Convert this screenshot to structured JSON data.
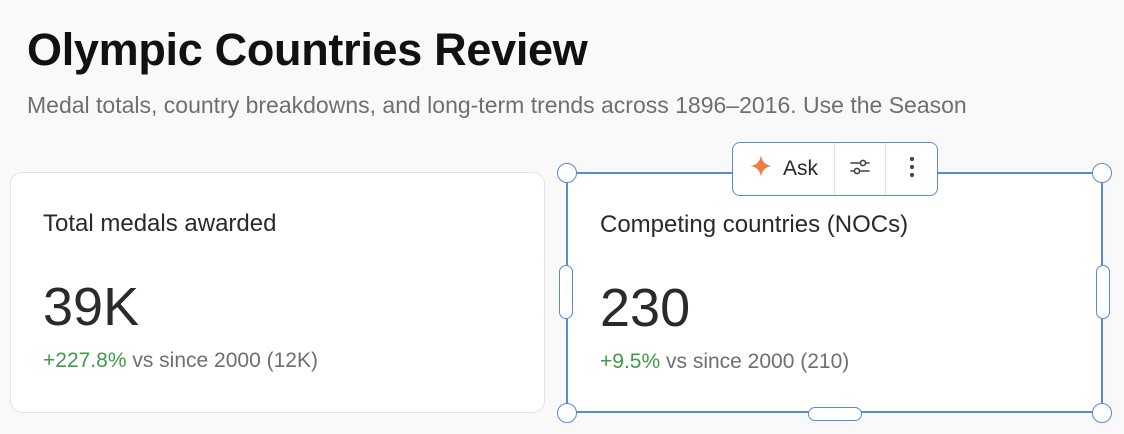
{
  "header": {
    "title": "Olympic Countries Review",
    "subtitle": "Medal totals, country breakdowns, and long-term trends across 1896–2016. Use the Season"
  },
  "cards": [
    {
      "title": "Total medals awarded",
      "value": "39K",
      "delta": "+227.8%",
      "comparison": "vs since 2000 (12K)"
    },
    {
      "title": "Competing countries (NOCs)",
      "value": "230",
      "delta": "+9.5%",
      "comparison": "vs since 2000 (210)"
    }
  ],
  "toolbar": {
    "ask_label": "Ask",
    "ask_icon": "sparkle-icon",
    "settings_icon": "sliders-icon",
    "more_icon": "more-vertical-icon"
  },
  "colors": {
    "positive": "#3f9b49",
    "selection": "#5a8ad6",
    "sparkle": "#ef7e45"
  }
}
